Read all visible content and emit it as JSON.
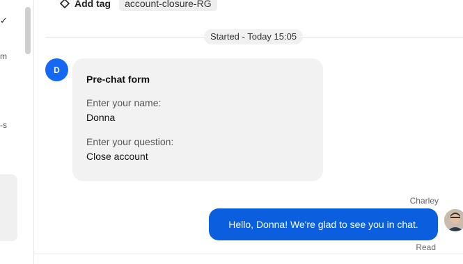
{
  "sidebar": {
    "fragments": [
      "m",
      "-s"
    ]
  },
  "toolbar": {
    "add_tag_label": "Add tag",
    "tag": "account-closure-RG"
  },
  "conversation": {
    "started_label": "Started - Today 15:05",
    "customer_initial": "D",
    "prechat_form": {
      "title": "Pre-chat form",
      "questions": [
        {
          "label": "Enter your name:",
          "answer": "Donna"
        },
        {
          "label": "Enter your question:",
          "answer": "Close account"
        }
      ]
    },
    "agent_message": {
      "author": "Charley",
      "text": "Hello, Donna! We're glad to see you in chat.",
      "status": "Read"
    }
  },
  "colors": {
    "accent": "#1468f3",
    "agent_bubble": "#0b5fde",
    "form_bubble": "#f2f2f2"
  }
}
